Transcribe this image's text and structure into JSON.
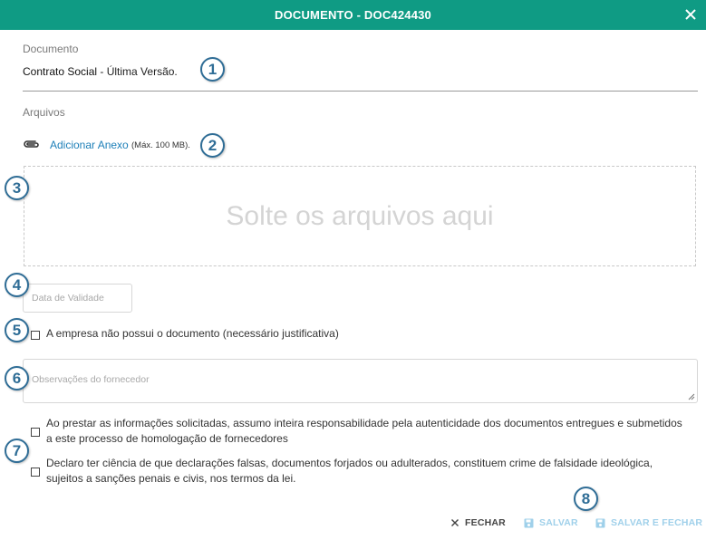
{
  "dialog": {
    "title": "DOCUMENTO - DOC424430",
    "header_color": "#0f9b84"
  },
  "documento": {
    "label": "Documento",
    "name": "Contrato Social",
    "separator": " - ",
    "version": "Última Versão."
  },
  "arquivos": {
    "label": "Arquivos",
    "add_link": "Adicionar Anexo",
    "max_size_note": "(Máx. 100 MB).",
    "dropzone_text": "Solte os arquivos aqui"
  },
  "validity": {
    "placeholder": "Data de Validade"
  },
  "no_document": {
    "label": "A empresa não possui o documento (necessário justificativa)",
    "checked": false
  },
  "observations": {
    "placeholder": "Observações do fornecedor"
  },
  "declarations": [
    {
      "line1": "Ao prestar as informações solicitadas, assumo inteira responsabilidade pela autenticidade dos documentos entregues e submetidos",
      "line2": "a este processo de homologação de fornecedores",
      "checked": false
    },
    {
      "line1": "Declaro ter ciência de que declarações falsas, documentos forjados ou adulterados, constituem crime de falsidade ideológica,",
      "line2": "sujeitos a sanções penais e civis, nos termos da lei.",
      "checked": false
    }
  ],
  "markers": [
    "1",
    "2",
    "3",
    "4",
    "5",
    "6",
    "7",
    "8"
  ],
  "footer": {
    "close_label": "FECHAR",
    "save_label": "SALVAR",
    "save_close_label": "SALVAR E FECHAR",
    "save_color": "#9fd0ea"
  },
  "icons": {
    "close": "close-icon",
    "attach": "paperclip-icon",
    "save": "floppy-disk-icon"
  }
}
